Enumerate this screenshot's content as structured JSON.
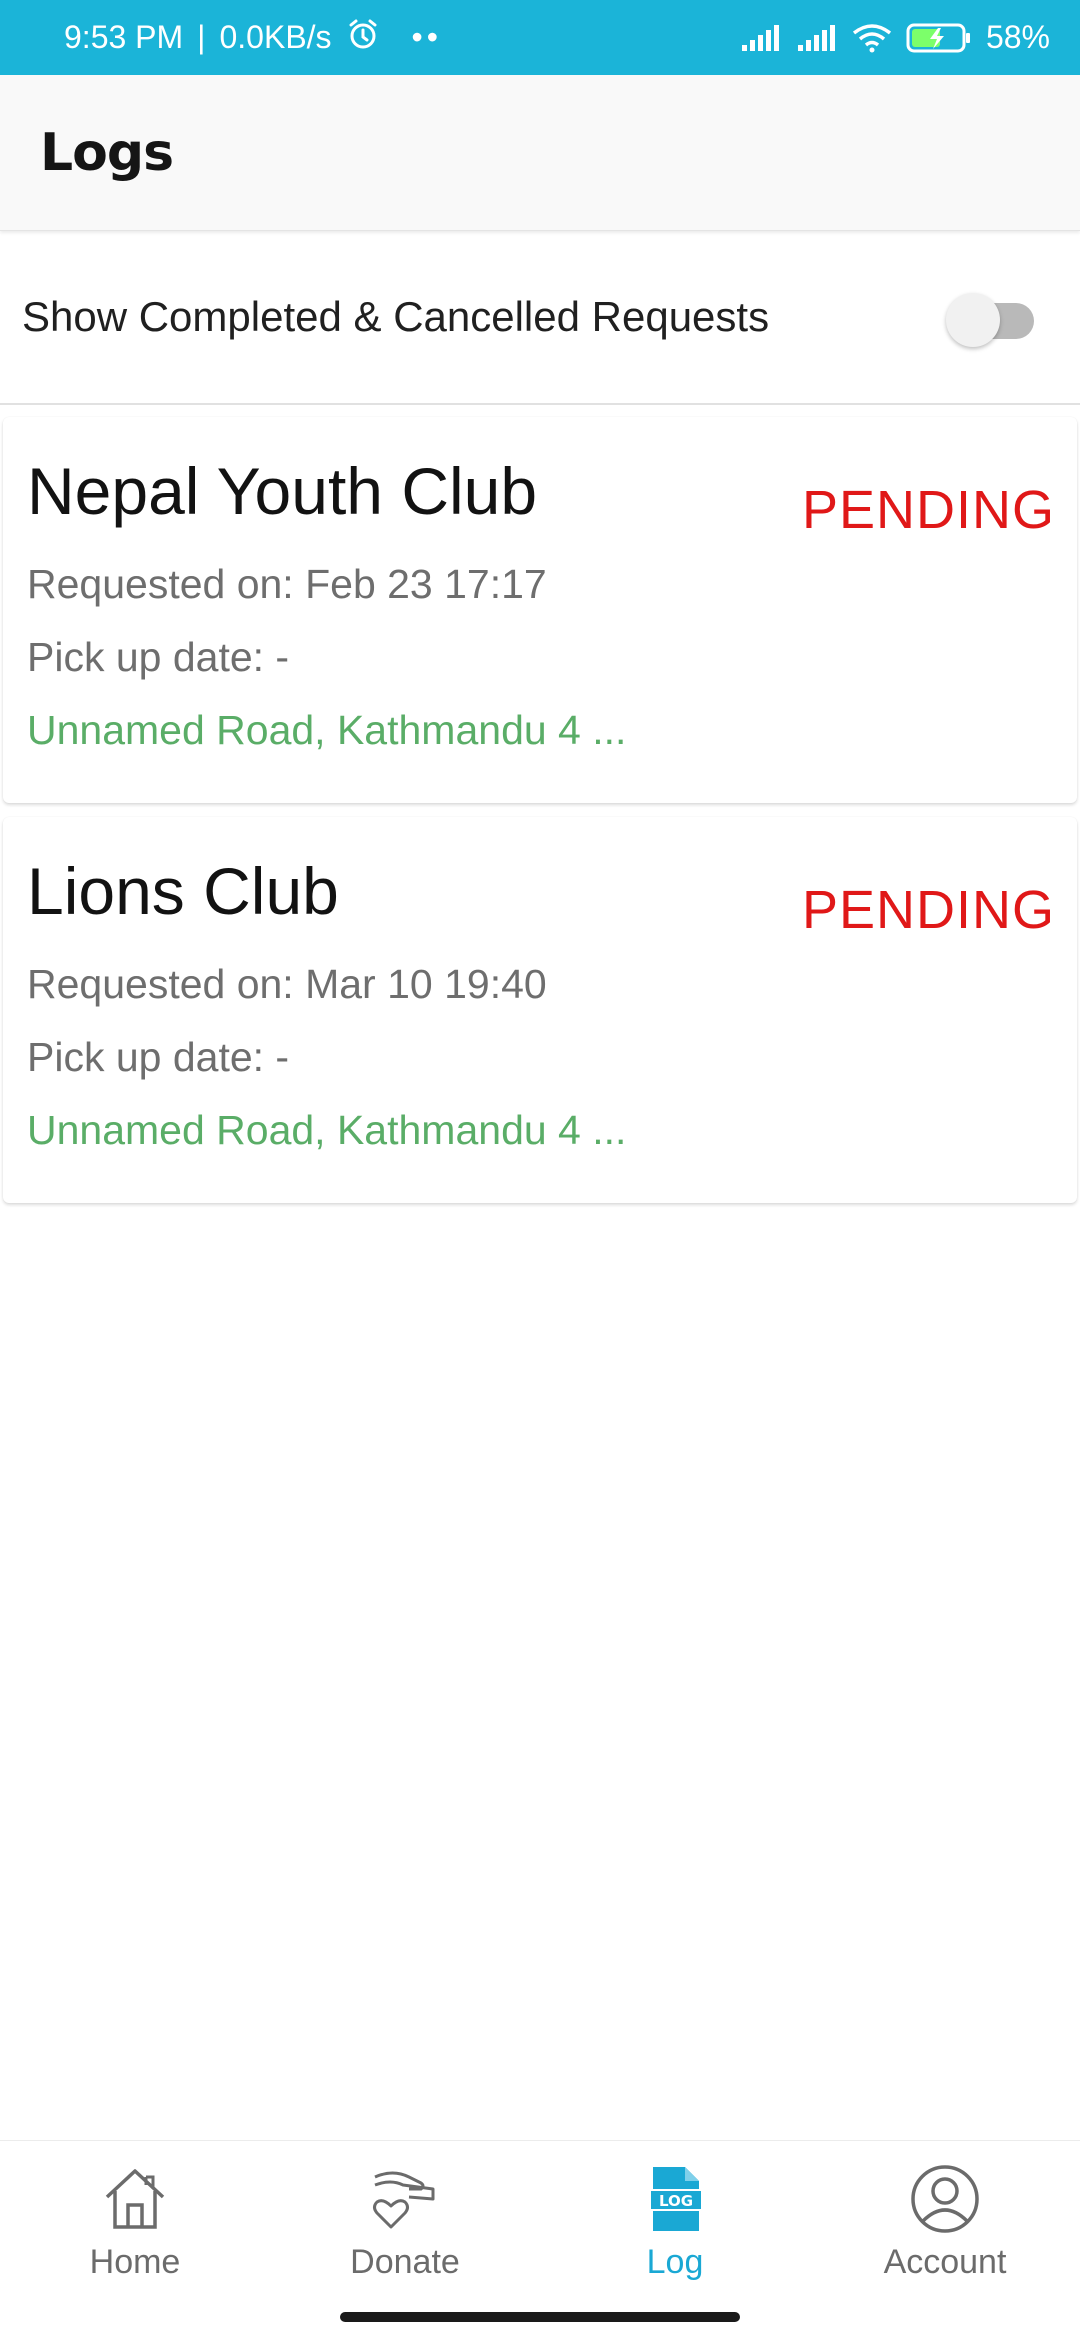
{
  "status_bar": {
    "time": "9:53 PM",
    "speed": "0.0KB/s",
    "dots": "••",
    "battery": "58%",
    "icons": [
      "alarm-icon",
      "signal-icon",
      "signal-icon",
      "wifi-icon",
      "battery-charging-icon"
    ]
  },
  "app_bar": {
    "title": "Logs"
  },
  "filter": {
    "label": "Show Completed & Cancelled Requests",
    "enabled": false
  },
  "requests": [
    {
      "name": "Nepal Youth Club",
      "status": "PENDING",
      "requested_on": "Requested on: Feb 23 17:17",
      "pickup_date": "Pick up date: -",
      "address": "Unnamed Road, Kathmandu 4 ..."
    },
    {
      "name": "Lions Club",
      "status": "PENDING",
      "requested_on": "Requested on: Mar 10 19:40",
      "pickup_date": "Pick up date: -",
      "address": "Unnamed Road, Kathmandu 4 ..."
    }
  ],
  "bottom_nav": {
    "items": [
      {
        "label": "Home",
        "icon": "home-icon"
      },
      {
        "label": "Donate",
        "icon": "donate-hand-heart-icon"
      },
      {
        "label": "Log",
        "icon": "log-document-icon",
        "active": true
      },
      {
        "label": "Account",
        "icon": "account-icon"
      }
    ]
  },
  "colors": {
    "status_bar": "#1bb4d8",
    "pending": "#e01818",
    "address": "#5aad67",
    "nav_active": "#1aa8d4",
    "nav_inactive": "#6b6b6b"
  }
}
